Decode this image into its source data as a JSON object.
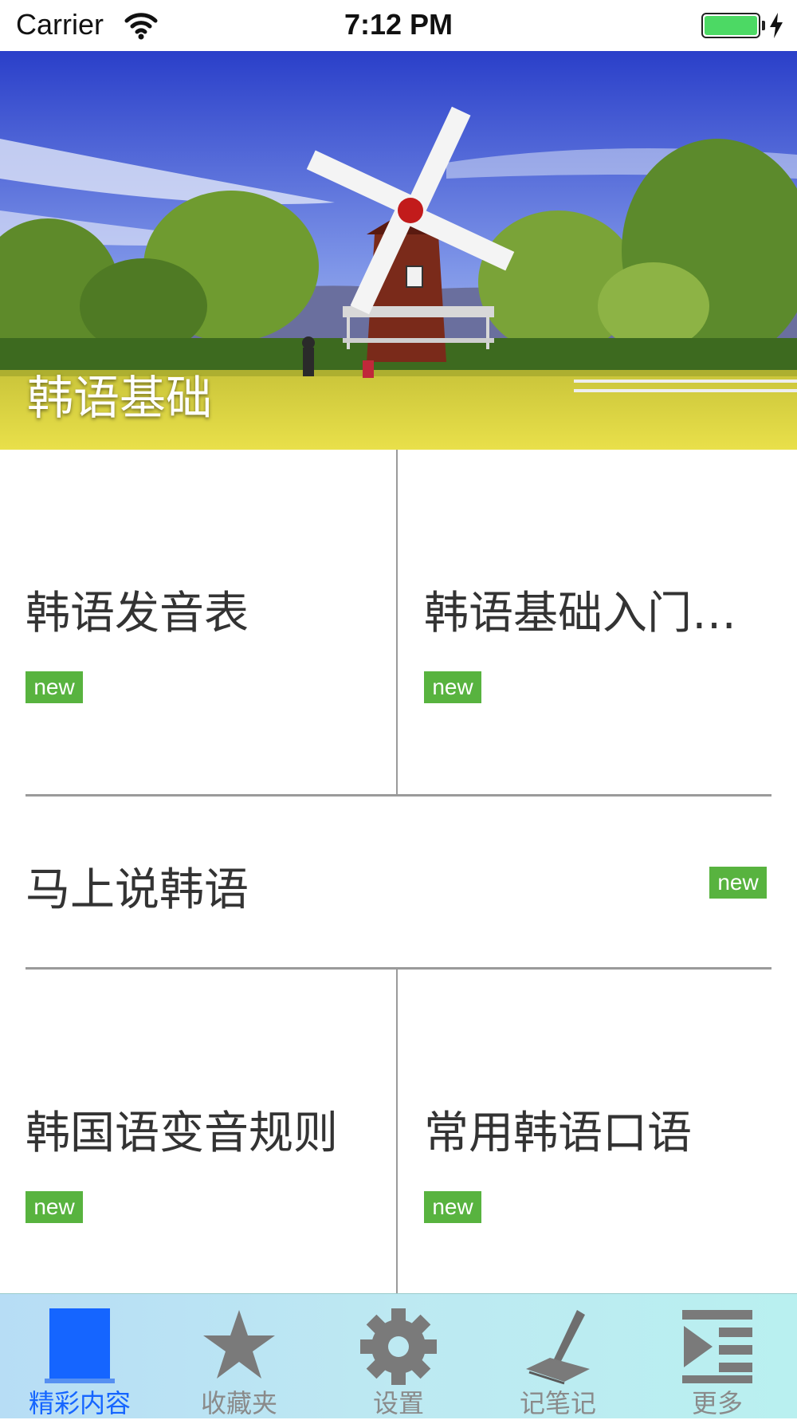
{
  "status_bar": {
    "carrier": "Carrier",
    "time": "7:12 PM",
    "battery_color": "#4cd964"
  },
  "banner": {
    "title": "韩语基础"
  },
  "items": [
    {
      "title": "韩语发音表",
      "badge": "new"
    },
    {
      "title": "韩语基础入门…",
      "badge": "new"
    },
    {
      "title": "马上说韩语",
      "badge": "new"
    },
    {
      "title": "韩国语变音规则",
      "badge": "new"
    },
    {
      "title": "常用韩语口语",
      "badge": "new"
    }
  ],
  "tab_bar": {
    "tabs": [
      {
        "label": "精彩内容",
        "icon": "book-icon",
        "active": true
      },
      {
        "label": "收藏夹",
        "icon": "star-icon",
        "active": false
      },
      {
        "label": "设置",
        "icon": "gear-icon",
        "active": false
      },
      {
        "label": "记笔记",
        "icon": "pen-icon",
        "active": false
      },
      {
        "label": "更多",
        "icon": "more-list-icon",
        "active": false
      }
    ],
    "active_color": "#1565ff",
    "inactive_color": "#8a8a8a"
  },
  "colors": {
    "badge": "#58b33f",
    "divider": "#9a9a9a"
  }
}
